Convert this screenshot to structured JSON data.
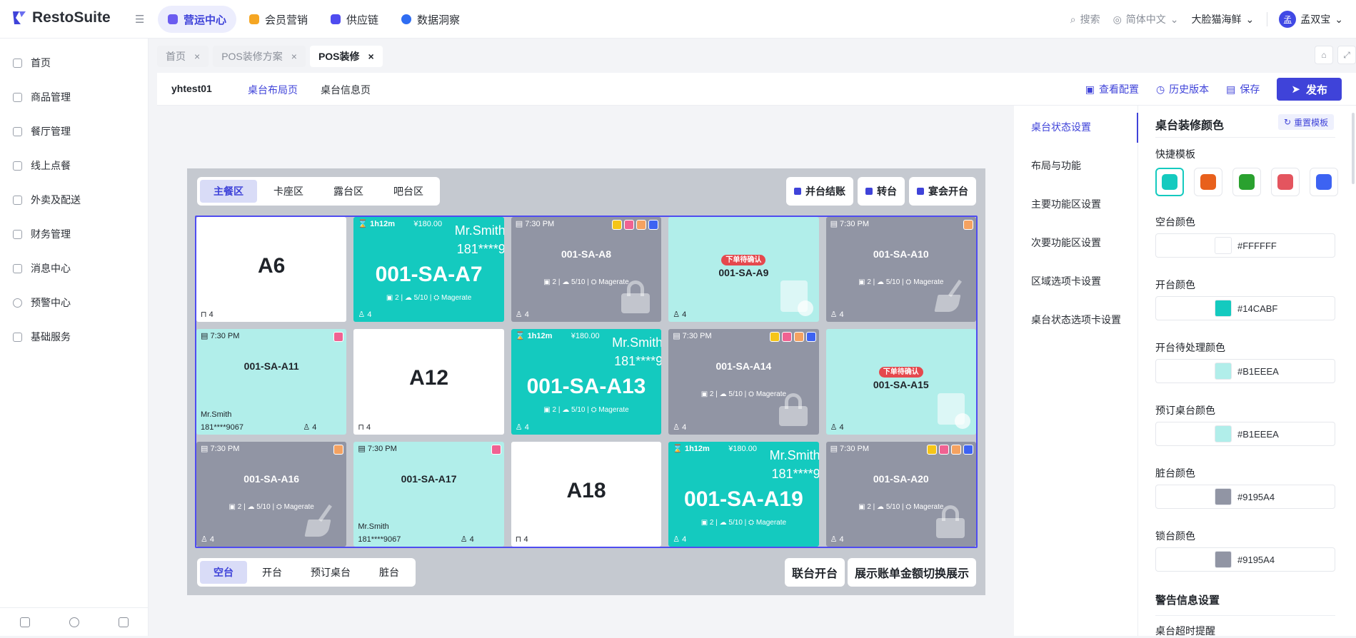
{
  "app": {
    "name": "RestoSuite"
  },
  "nav": [
    {
      "label": "营运中心",
      "color": "#5a4be8",
      "active": true
    },
    {
      "label": "会员营销",
      "color": "#f5a623"
    },
    {
      "label": "供应链",
      "color": "#4f4cf0"
    },
    {
      "label": "数据洞察",
      "color": "#2f6df2"
    }
  ],
  "top": {
    "search": "搜索",
    "lang": "简体中文",
    "org": "大脸猫海鲜",
    "user": "孟双宝",
    "avatar_char": "孟"
  },
  "sidebar": [
    {
      "label": "首页"
    },
    {
      "label": "商品管理"
    },
    {
      "label": "餐厅管理"
    },
    {
      "label": "线上点餐"
    },
    {
      "label": "外卖及配送"
    },
    {
      "label": "财务管理"
    },
    {
      "label": "消息中心"
    },
    {
      "label": "预警中心"
    },
    {
      "label": "基础服务"
    }
  ],
  "tabs": [
    {
      "label": "首页"
    },
    {
      "label": "POS装修方案"
    },
    {
      "label": "POS装修"
    }
  ],
  "toolbar": {
    "store": "yhtest01",
    "subtab1": "桌台布局页",
    "subtab2": "桌台信息页",
    "view_config": "查看配置",
    "history": "历史版本",
    "save": "保存",
    "publish": "发布"
  },
  "areas": [
    "主餐区",
    "卡座区",
    "露台区",
    "吧台区"
  ],
  "area_buttons": [
    "并台结账",
    "转台",
    "宴会开台"
  ],
  "tables": {
    "A6": "A6",
    "A7": "001-SA-A7",
    "A8": "001-SA-A8",
    "A9": "001-SA-A9",
    "A10": "001-SA-A10",
    "A11": "001-SA-A11",
    "A12": "A12",
    "A13": "001-SA-A13",
    "A14": "001-SA-A14",
    "A15": "001-SA-A15",
    "A16": "001-SA-A16",
    "A17": "001-SA-A17",
    "A18": "A18",
    "A19": "001-SA-A19",
    "A20": "001-SA-A20"
  },
  "table_meta": {
    "seats": "4",
    "time": "7:30 PM",
    "duration": "1h12m",
    "amount": "¥180.00",
    "guest_name": "Mr.Smith",
    "guest_phone_short": "181****9",
    "guest_phone": "181****9067",
    "info": "▣ 2 | ☁ 5/10 | ⛭ Magerate",
    "pending": "下单待确认"
  },
  "status_tabs": [
    "空台",
    "开台",
    "预订桌台",
    "脏台"
  ],
  "status_buttons": [
    "联台开台",
    "展示账单金额切换展示"
  ],
  "settings_nav": [
    "桌台状态设置",
    "布局与功能",
    "主要功能区设置",
    "次要功能区设置",
    "区域选项卡设置",
    "桌台状态选项卡设置"
  ],
  "panel": {
    "title": "桌台装修颜色",
    "reset": "重置模板",
    "quick": "快捷模板",
    "swatches": [
      "#14cabf",
      "#e8601c",
      "#2aa12f",
      "#e4555f",
      "#3d63f2"
    ],
    "colors": [
      {
        "label": "空台颜色",
        "value": "#FFFFFF",
        "hex": "#ffffff"
      },
      {
        "label": "开台颜色",
        "value": "#14CABF",
        "hex": "#14cabf"
      },
      {
        "label": "开台待处理颜色",
        "value": "#B1EEEA",
        "hex": "#b1eeea"
      },
      {
        "label": "预订桌台颜色",
        "value": "#B1EEEA",
        "hex": "#b1eeea"
      },
      {
        "label": "脏台颜色",
        "value": "#9195A4",
        "hex": "#9195a4"
      },
      {
        "label": "锁台颜色",
        "value": "#9195A4",
        "hex": "#9195a4"
      }
    ],
    "warn_title": "警告信息设置",
    "warn_item": "桌台超时提醒"
  }
}
